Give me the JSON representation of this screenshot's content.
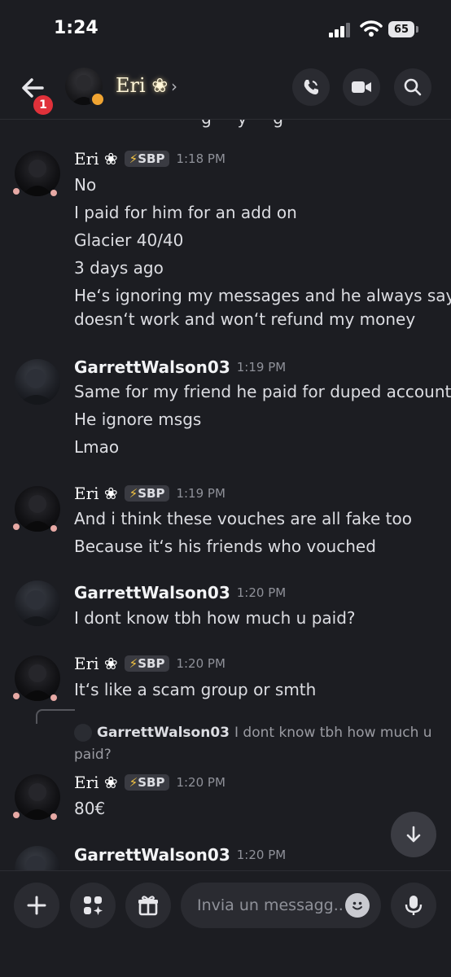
{
  "status_bar": {
    "time": "1:24",
    "battery": "65"
  },
  "header": {
    "unread_count": "1",
    "channel_name": "Eri ❀",
    "chevron": "›"
  },
  "messages": {
    "cut_text": "···· ··· ··· ··· ···g ··· y ··· g ···",
    "m1": {
      "author": "Eri ❀",
      "tag": "SBP",
      "time": "1:18 PM",
      "lines": [
        "No",
        "I paid for him for an add on",
        "Glacier 40/40",
        "3 days ago",
        "He‘s ignoring my messages and he always says",
        "doesn‘t work and won‘t refund my money"
      ]
    },
    "m2": {
      "author": "GarrettWalson03",
      "time": "1:19 PM",
      "lines": [
        "Same for my friend he paid for duped account",
        "He ignore msgs",
        "Lmao"
      ]
    },
    "m3": {
      "author": "Eri ❀",
      "tag": "SBP",
      "time": "1:19 PM",
      "lines": [
        "And i think these vouches are all fake too",
        "Because it‘s his friends who vouched"
      ]
    },
    "m4": {
      "author": "GarrettWalson03",
      "time": "1:20 PM",
      "lines": [
        "I dont know tbh how much u paid?"
      ]
    },
    "m5": {
      "author": "Eri ❀",
      "tag": "SBP",
      "time": "1:20 PM",
      "lines": [
        "It‘s like a scam group or smth"
      ]
    },
    "reply": {
      "author": "GarrettWalson03",
      "text": "I dont know tbh how much u",
      "text2": "paid?"
    },
    "m6": {
      "author": "Eri ❀",
      "tag": "SBP",
      "time": "1:20 PM",
      "lines": [
        "80€"
      ]
    },
    "m7": {
      "author": "GarrettWalson03",
      "time": "1:20 PM"
    }
  },
  "composer": {
    "placeholder": "Invia un messagg.."
  },
  "colors": {
    "background": "#1c1d22",
    "badge_red": "#e0313a",
    "idle": "#f0a432",
    "tag_bolt": "#f5c542"
  },
  "icons": [
    "back-arrow-icon",
    "phone-icon",
    "video-camera-icon",
    "search-icon",
    "chevron-down-icon",
    "plus-icon",
    "apps-icon",
    "gift-icon",
    "emoji-icon",
    "microphone-icon"
  ]
}
